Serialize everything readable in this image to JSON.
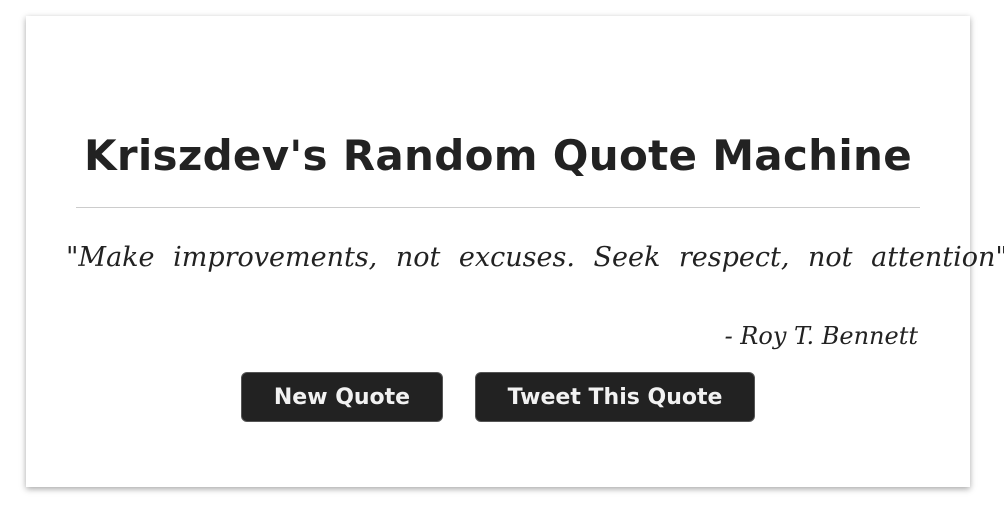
{
  "header": {
    "title": "Kriszdev's Random Quote Machine"
  },
  "quote": {
    "text": "\"Make improvements, not excuses. Seek respect, not attention\"",
    "author": "- Roy T. Bennett"
  },
  "actions": {
    "new_quote_label": "New Quote",
    "tweet_label": "Tweet This Quote"
  },
  "colors": {
    "button_bg": "#222222",
    "text": "#222222",
    "divider": "#cccccc"
  }
}
